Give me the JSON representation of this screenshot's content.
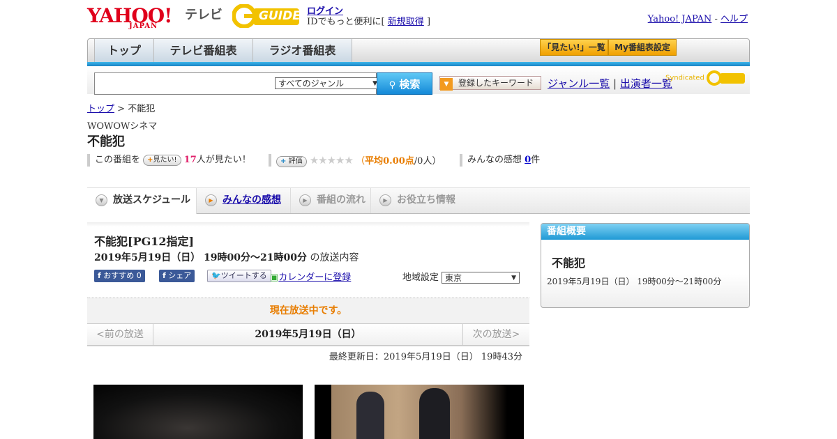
{
  "header": {
    "logo_text": "YAHOO!",
    "logo_sub": "JAPAN",
    "tv_label": "テレビ",
    "gguide_text": "GUIDE",
    "login_link": "ログイン",
    "id_text": "IDでもっと便利に[",
    "register_link": "新規取得",
    "id_text_end": "]",
    "yahoo_japan_link": "Yahoo! JAPAN",
    "separator": "-",
    "help_link": "ヘルプ"
  },
  "nav": {
    "tabs": [
      "トップ",
      "テレビ番組表",
      "ラジオ番組表"
    ],
    "want_list": "「見たい!」一覧",
    "my_guide": "My番組表設定"
  },
  "search": {
    "input_value": "",
    "genre_selected": "すべてのジャンル",
    "search_button": "検索",
    "keyword_button": "登録したキーワード",
    "genre_list_link": "ジャンル一覧",
    "pipe": "|",
    "performer_list_link": "出演者一覧",
    "syndicated": "Syndicated"
  },
  "breadcrumb": {
    "top_link": "トップ",
    "sep": ">",
    "current": "不能犯"
  },
  "program": {
    "channel": "WOWOWシネマ",
    "title": "不能犯",
    "want_prefix": "この番組を",
    "want_button": "見たい!",
    "want_count": "17",
    "want_suffix": "人が見たい！",
    "rate_button": "評価",
    "stars": "★★★★★",
    "rating_open": "（",
    "rating_label": "平均0.00点",
    "rating_people": "/0人）",
    "impressions_label": "みんなの感想",
    "impressions_count": "0",
    "impressions_suffix": "件"
  },
  "content_tabs": [
    "放送スケジュール",
    "みんなの感想",
    "番組の流れ",
    "お役立ち情報"
  ],
  "broadcast": {
    "title": "不能犯[PG12指定]",
    "date_time": "2019年5月19日（日） 19時00分～21時00分",
    "date_suffix": "の放送内容",
    "recommend_button": "おすすめ 0",
    "share_button": "シェア",
    "tweet_button": "ツイートする",
    "calendar_link": "カレンダーに登録",
    "region_label": "地域設定",
    "region_selected": "東京",
    "on_air_status": "現在放送中です。",
    "prev_broadcast": "<前の放送",
    "current_date": "2019年5月19日（日）",
    "next_broadcast": "次の放送>",
    "last_updated": "最終更新日：2019年5月19日（日） 19時43分"
  },
  "sidebar": {
    "header": "番組概要",
    "title": "不能犯",
    "date_time": "2019年5月19日（日） 19時00分～21時00分"
  },
  "colors": {
    "yahoo_red": "#e0001b",
    "nav_blue": "#1a83c4",
    "accent_orange": "#e87d00",
    "link": "#1a0dab"
  }
}
